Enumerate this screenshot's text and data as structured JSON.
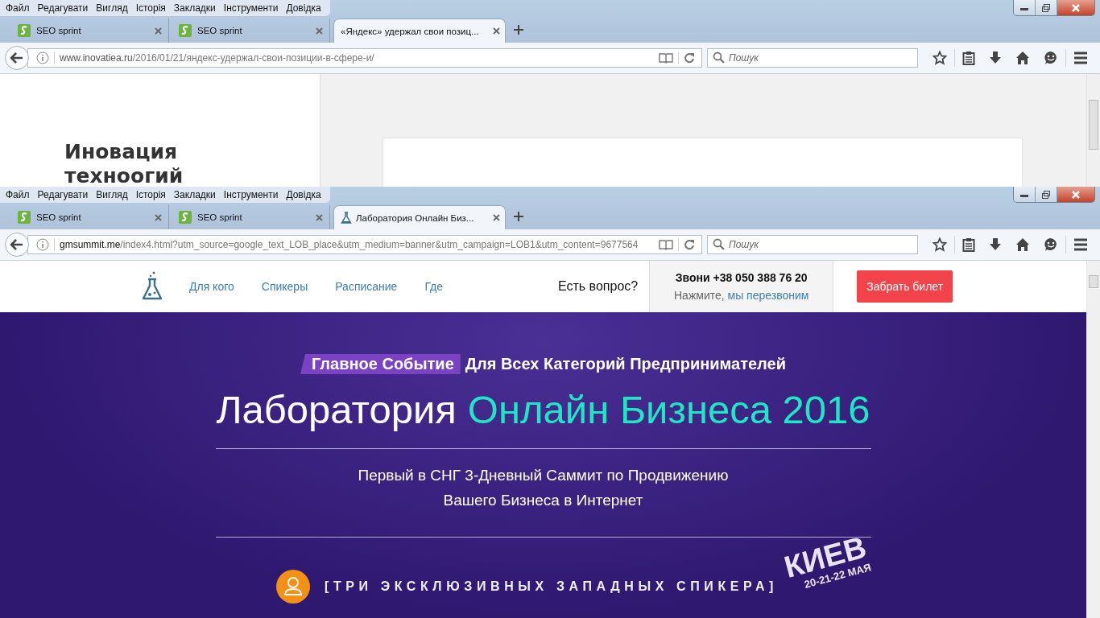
{
  "windows": [
    {
      "menu": [
        "Файл",
        "Редагувати",
        "Вигляд",
        "Історія",
        "Закладки",
        "Інструменти",
        "Довідка"
      ],
      "tabs": [
        {
          "label": "SEO sprint",
          "kind": "seo",
          "selected": false
        },
        {
          "label": "SEO sprint",
          "kind": "seo",
          "selected": false
        },
        {
          "label": "«Яндекс» удержал свои позиц...",
          "kind": "plain",
          "selected": true
        }
      ],
      "url": {
        "host": "www.inovatiea.ru",
        "path": "/2016/01/21/яндекс-удержал-свои-позиции-в-сфере-и/"
      },
      "search": {
        "placeholder": "Пошук"
      },
      "page": {
        "kind": "blog",
        "heading": "Иновация техноогий"
      }
    },
    {
      "menu": [
        "Файл",
        "Редагувати",
        "Вигляд",
        "Історія",
        "Закладки",
        "Інструменти",
        "Довідка"
      ],
      "tabs": [
        {
          "label": "SEO sprint",
          "kind": "seo",
          "selected": false
        },
        {
          "label": "SEO sprint",
          "kind": "seo",
          "selected": false
        },
        {
          "label": "Лаборатория Онлайн Биз...",
          "kind": "lab",
          "selected": true
        }
      ],
      "url": {
        "host": "gmsummit.me",
        "path": "/index4.html?utm_source=google_text_LOB_place&utm_medium=banner&utm_campaign=LOB1&utm_content=9677564"
      },
      "search": {
        "placeholder": "Пошук"
      },
      "page": {
        "kind": "landing",
        "nav": [
          "Для кого",
          "Спикеры",
          "Расписание",
          "Где"
        ],
        "question": "Есть вопрос?",
        "phone": "Звони +38 050 388 76 20",
        "callback_prefix": "Нажмите,",
        "callback_link": "мы перезвоним",
        "cta": "Забрать билет",
        "badge": "Главное Событие",
        "tagline": "Для Всех Категорий Предпринимателей",
        "title_plain": "Лаборатория",
        "title_accent": "Онлайн Бизнеса 2016",
        "subtitle": [
          "Первый в СНГ 3-Дневный Саммит по Продвижению",
          "Вашего Бизнеса в Интернет"
        ],
        "speakers": "[ТРИ ЭКСКЛЮЗИВНЫХ ЗАПАДНЫХ СПИКЕРА]",
        "city": "КИЕВ",
        "dates": "20-21-22 МАЯ"
      }
    }
  ]
}
